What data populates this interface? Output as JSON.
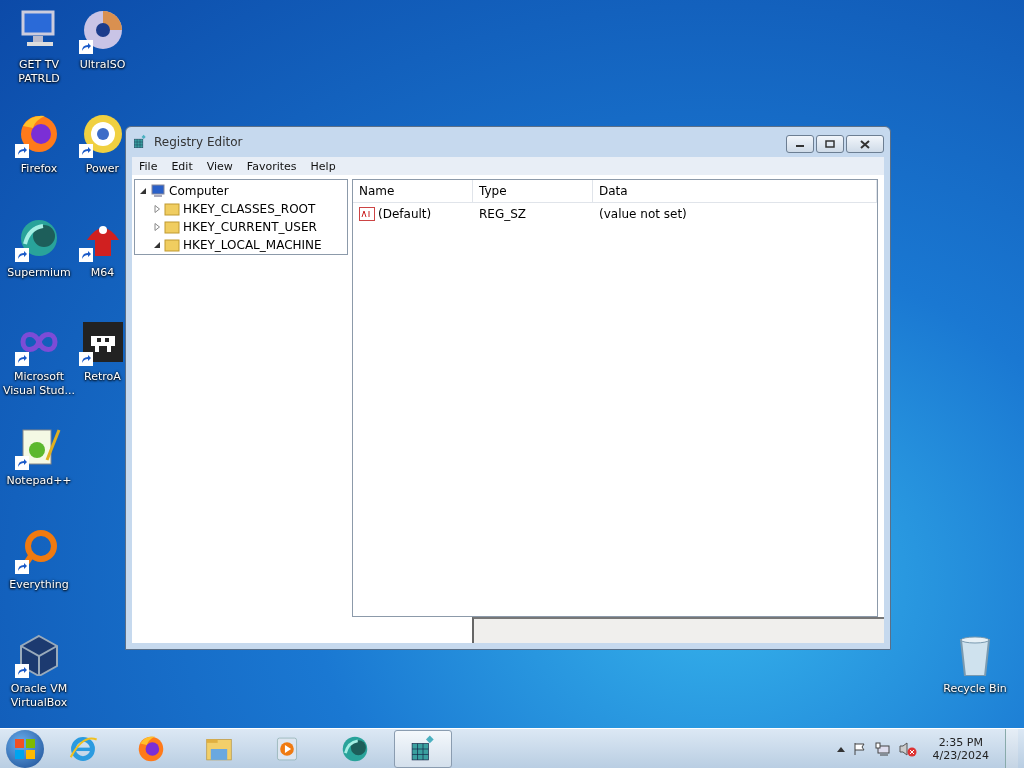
{
  "desktop_columns": [
    {
      "icons": [
        {
          "kind": "computer",
          "label": "GET TV PATRLD",
          "shortcut": false
        },
        {
          "kind": "firefox",
          "label": "Firefox",
          "shortcut": true
        },
        {
          "kind": "supermium",
          "label": "Supermium",
          "shortcut": true
        },
        {
          "kind": "infinity",
          "label": "Microsoft Visual Stud...",
          "shortcut": true
        },
        {
          "kind": "notepad",
          "label": "Notepad++",
          "shortcut": true
        },
        {
          "kind": "ring",
          "label": "Everything",
          "shortcut": true
        },
        {
          "kind": "cube",
          "label": "Oracle VM VirtualBox",
          "shortcut": true
        }
      ]
    },
    {
      "icons": [
        {
          "kind": "disc",
          "label": "UltraISO",
          "shortcut": true
        },
        {
          "kind": "disc-gold",
          "label": "Power",
          "shortcut": true
        },
        {
          "kind": "game",
          "label": "M64",
          "shortcut": true
        },
        {
          "kind": "invader",
          "label": "RetroA",
          "shortcut": true
        }
      ]
    }
  ],
  "recycle_bin": {
    "kind": "bin",
    "label": "Recycle Bin",
    "shortcut": false
  },
  "window": {
    "title": "Registry Editor",
    "menu": [
      "File",
      "Edit",
      "View",
      "Favorites",
      "Help"
    ],
    "tree": [
      {
        "label": "Computer",
        "kind": "computer",
        "expanded": true,
        "children": [
          {
            "label": "HKEY_CLASSES_ROOT",
            "kind": "folder",
            "expanded": false
          },
          {
            "label": "HKEY_CURRENT_USER",
            "kind": "folder",
            "expanded": false
          },
          {
            "label": "HKEY_LOCAL_MACHINE",
            "kind": "folder",
            "expanded": true
          }
        ]
      }
    ],
    "columns": [
      "Name",
      "Type",
      "Data"
    ],
    "rows": [
      {
        "name": "(Default)",
        "type": "REG_SZ",
        "data": "(value not set)"
      }
    ]
  },
  "taskbar": {
    "items": [
      {
        "kind": "ie",
        "selected": false
      },
      {
        "kind": "firefox",
        "selected": false
      },
      {
        "kind": "explorer",
        "selected": false
      },
      {
        "kind": "media",
        "selected": false
      },
      {
        "kind": "supermium",
        "selected": false
      },
      {
        "kind": "regedit",
        "selected": true
      }
    ],
    "time": "2:35 PM",
    "date": "4/23/2024"
  }
}
